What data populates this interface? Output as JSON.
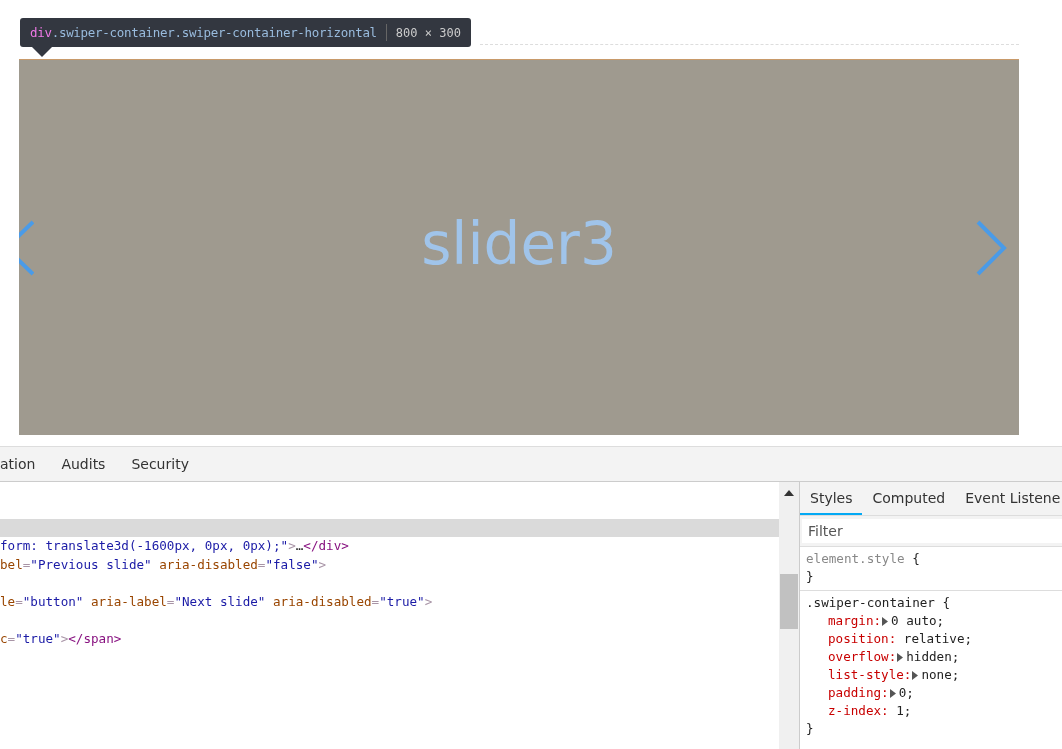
{
  "tooltip": {
    "tag": "div",
    "classes": ".swiper-container.swiper-container-horizontal",
    "size": "800 × 300"
  },
  "slider": {
    "slide_text": "slider3"
  },
  "devtools": {
    "tabs": [
      {
        "label": "ation",
        "selected": false
      },
      {
        "label": "Audits",
        "selected": false
      },
      {
        "label": "Security",
        "selected": false
      }
    ],
    "code_lines": [
      {
        "selected": true
      },
      {
        "selected": false,
        "segments": [
          {
            "kind": "value",
            "text": "form: translate3d(-1600px, 0px, 0px);\""
          },
          {
            "kind": "punct",
            "text": ">"
          },
          {
            "kind": "plain",
            "text": "…"
          },
          {
            "kind": "tag",
            "text": "</div>"
          }
        ]
      },
      {
        "selected": false,
        "segments": [
          {
            "kind": "attr",
            "text": "bel"
          },
          {
            "kind": "punct",
            "text": "="
          },
          {
            "kind": "value",
            "text": "\"Previous slide\""
          },
          {
            "kind": "attr",
            "text": " aria-disabled"
          },
          {
            "kind": "punct",
            "text": "="
          },
          {
            "kind": "value",
            "text": "\"false\""
          },
          {
            "kind": "punct",
            "text": ">"
          }
        ]
      },
      {
        "selected": false
      },
      {
        "selected": false,
        "segments": [
          {
            "kind": "attr",
            "text": "le"
          },
          {
            "kind": "punct",
            "text": "="
          },
          {
            "kind": "value",
            "text": "\"button\""
          },
          {
            "kind": "attr",
            "text": " aria-label"
          },
          {
            "kind": "punct",
            "text": "="
          },
          {
            "kind": "value",
            "text": "\"Next slide\""
          },
          {
            "kind": "attr",
            "text": " aria-disabled"
          },
          {
            "kind": "punct",
            "text": "="
          },
          {
            "kind": "value",
            "text": "\"true\""
          },
          {
            "kind": "punct",
            "text": ">"
          }
        ]
      },
      {
        "selected": false
      },
      {
        "selected": false,
        "segments": [
          {
            "kind": "attr",
            "text": "c"
          },
          {
            "kind": "punct",
            "text": "="
          },
          {
            "kind": "value",
            "text": "\"true\""
          },
          {
            "kind": "punct",
            "text": ">"
          },
          {
            "kind": "tag",
            "text": "</span>"
          }
        ]
      }
    ],
    "styles_tabs": [
      {
        "label": "Styles",
        "selected": true
      },
      {
        "label": "Computed",
        "selected": false
      },
      {
        "label": "Event Listene",
        "selected": false
      }
    ],
    "filter": {
      "placeholder": "Filter"
    },
    "rules": [
      {
        "selector": "element.style",
        "open": "{",
        "close": "}"
      },
      {
        "selector": ".swiper-container",
        "open": "{",
        "close": "}",
        "properties": [
          {
            "name": "margin:",
            "value": "0 auto;",
            "expandable": true
          },
          {
            "name": "position:",
            "value": "relative;",
            "expandable": false
          },
          {
            "name": "overflow:",
            "value": "hidden;",
            "expandable": true
          },
          {
            "name": "list-style:",
            "value": "none;",
            "expandable": true
          },
          {
            "name": "padding:",
            "value": "0;",
            "expandable": true
          },
          {
            "name": "z-index:",
            "value": "1;",
            "expandable": false
          }
        ]
      }
    ]
  }
}
